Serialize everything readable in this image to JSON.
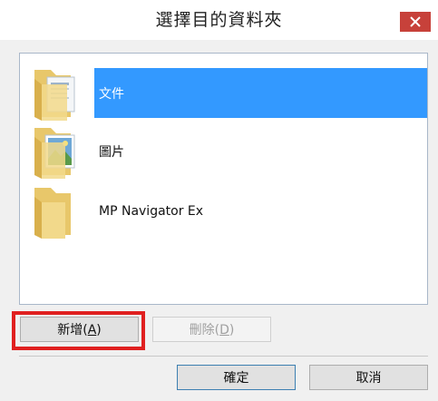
{
  "dialog": {
    "title": "選擇目的資料夾",
    "close_icon": "close-icon"
  },
  "folders": [
    {
      "label": "文件",
      "icon": "folder-documents-icon",
      "selected": true
    },
    {
      "label": "圖片",
      "icon": "folder-pictures-icon",
      "selected": false
    },
    {
      "label": "MP Navigator Ex",
      "icon": "folder-icon",
      "selected": false
    }
  ],
  "buttons": {
    "new_pre": "新增(",
    "new_key": "A",
    "new_post": ")",
    "delete_pre": "刪除(",
    "delete_key": "D",
    "delete_post": ")",
    "ok": "確定",
    "cancel": "取消"
  },
  "colors": {
    "selection": "#3399ff",
    "close_button": "#c7413a",
    "highlight": "#e02020"
  }
}
